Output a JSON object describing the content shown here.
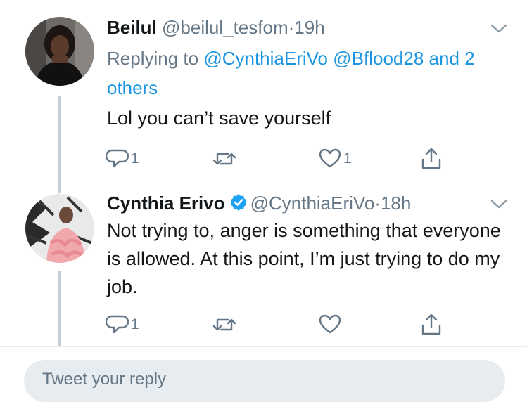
{
  "tweets": [
    {
      "name": "Beilul",
      "handle": "@beilul_tesfom",
      "separator": "·",
      "time": "19h",
      "replying_prefix": "Replying to",
      "mention_1": "@CynthiaEriVo",
      "mention_2": "@Bflood28",
      "others_text": "and 2 others",
      "text": "Lol you can’t save yourself",
      "reply_count": "1",
      "retweet_count": "",
      "like_count": "1"
    },
    {
      "name": "Cynthia Erivo",
      "handle": "@CynthiaEriVo",
      "separator": "·",
      "time": "18h",
      "verified": true,
      "text": "Not trying to, anger is something that everyone is allowed. At this point, I’m just trying to do my job.",
      "reply_count": "1",
      "retweet_count": "",
      "like_count": ""
    }
  ],
  "icons": {
    "reply": "reply-icon",
    "retweet": "retweet-icon",
    "like": "heart-icon",
    "share": "share-icon",
    "caret": "chevron-down-icon",
    "verified": "verified-badge-icon"
  },
  "colors": {
    "text": "#14171a",
    "secondary": "#657786",
    "link": "#1b95e0",
    "verified": "#1da1f2",
    "thread_line": "#c4cfd6"
  },
  "compose": {
    "placeholder": "Tweet your reply"
  }
}
